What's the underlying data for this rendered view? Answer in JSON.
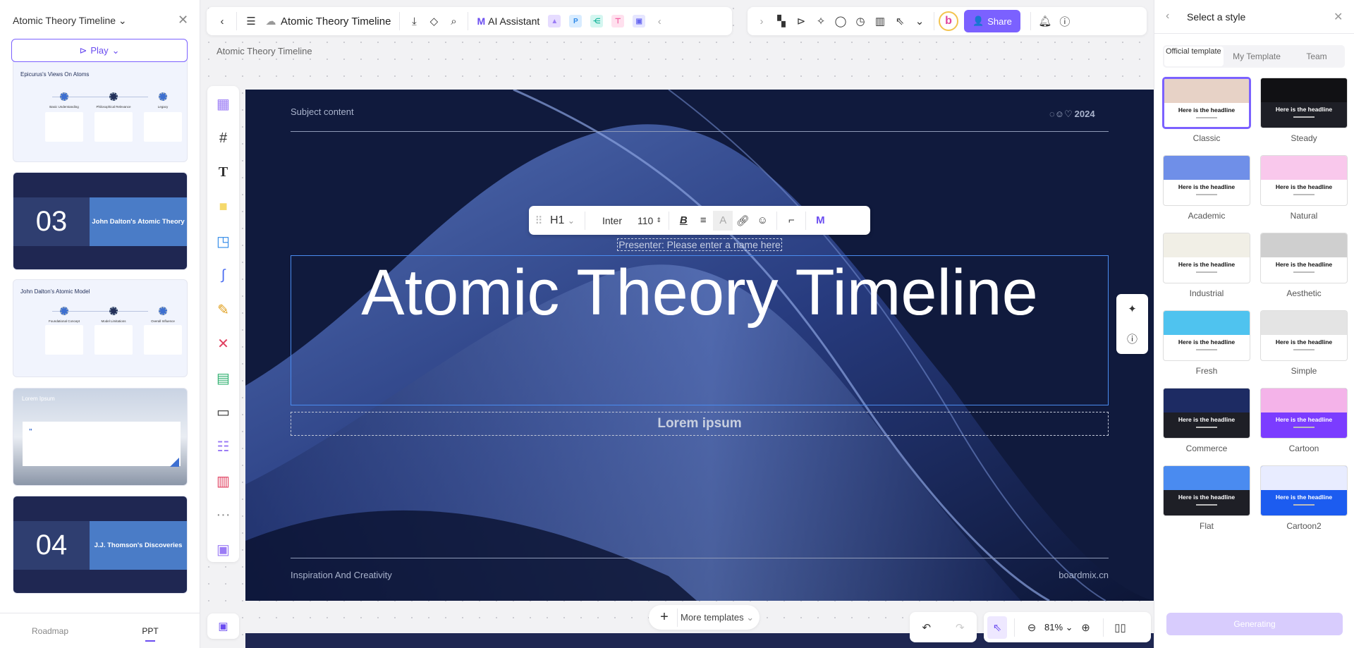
{
  "left_panel": {
    "title": "Atomic Theory Timeline",
    "play_label": "Play",
    "slides": [
      {
        "type": "timeline",
        "title": "Epicurus's Views On Atoms",
        "steps": [
          "Basic Understanding",
          "Philosophical Relevance",
          "Legacy"
        ]
      },
      {
        "type": "section",
        "number": "03",
        "title": "John Dalton's Atomic Theory"
      },
      {
        "type": "timeline",
        "title": "John Dalton's Atomic Model",
        "steps": [
          "Foundational Concept",
          "Model Limitations",
          "Overall Influence"
        ]
      },
      {
        "type": "image",
        "title": "Lorem Ipsum"
      },
      {
        "type": "section",
        "number": "04",
        "title": "J.J. Thomson's Discoveries"
      }
    ],
    "tabs": [
      {
        "label": "Roadmap",
        "active": false
      },
      {
        "label": "PPT",
        "active": true
      }
    ]
  },
  "toolbar": {
    "doc_title": "Atomic Theory Timeline",
    "ai_assistant": "AI Assistant",
    "share": "Share"
  },
  "breadcrumb": "Atomic Theory Timeline",
  "slide": {
    "subject": "Subject content",
    "year": "2024",
    "presenter": "Presenter: Please enter a name here",
    "title": "Atomic Theory Timeline",
    "subtitle": "Lorem ipsum",
    "footer_left": "Inspiration And Creativity",
    "footer_right": "boardmix.cn"
  },
  "format_toolbar": {
    "heading": "H1",
    "font": "Inter",
    "size": "110"
  },
  "bottom": {
    "more_templates": "More templates",
    "zoom": "81%"
  },
  "right_panel": {
    "title": "Select a style",
    "tabs": [
      "Official template",
      "My Template",
      "Team"
    ],
    "active_tab": "Official template",
    "headline": "Here is the headline",
    "styles": [
      {
        "name": "Classic",
        "selected": true,
        "color": "#e7d2c6",
        "dark": false
      },
      {
        "name": "Steady",
        "color": "#111114",
        "dark": true
      },
      {
        "name": "Academic",
        "color": "#6f8fe8",
        "dark": false
      },
      {
        "name": "Natural",
        "color": "#f9c8ec",
        "dark": false
      },
      {
        "name": "Industrial",
        "color": "#f1efe6",
        "dark": false
      },
      {
        "name": "Aesthetic",
        "color": "#cfcfcf",
        "dark": false
      },
      {
        "name": "Fresh",
        "color": "#4fc3ef",
        "dark": false
      },
      {
        "name": "Simple",
        "color": "#e4e4e4",
        "dark": false
      },
      {
        "name": "Commerce",
        "color": "#1d2b63",
        "dark": true
      },
      {
        "name": "Cartoon",
        "color": "#f4b3e9",
        "dark": false,
        "band": "#7b3cff"
      },
      {
        "name": "Flat",
        "color": "#4a8bf0",
        "dark": true
      },
      {
        "name": "Cartoon2",
        "color": "#e8ecff",
        "dark": false,
        "band": "#1c5cf0"
      }
    ],
    "generating": "Generating"
  },
  "colors": {
    "accent": "#7b61ff",
    "slide_bg": "#0f1838"
  }
}
